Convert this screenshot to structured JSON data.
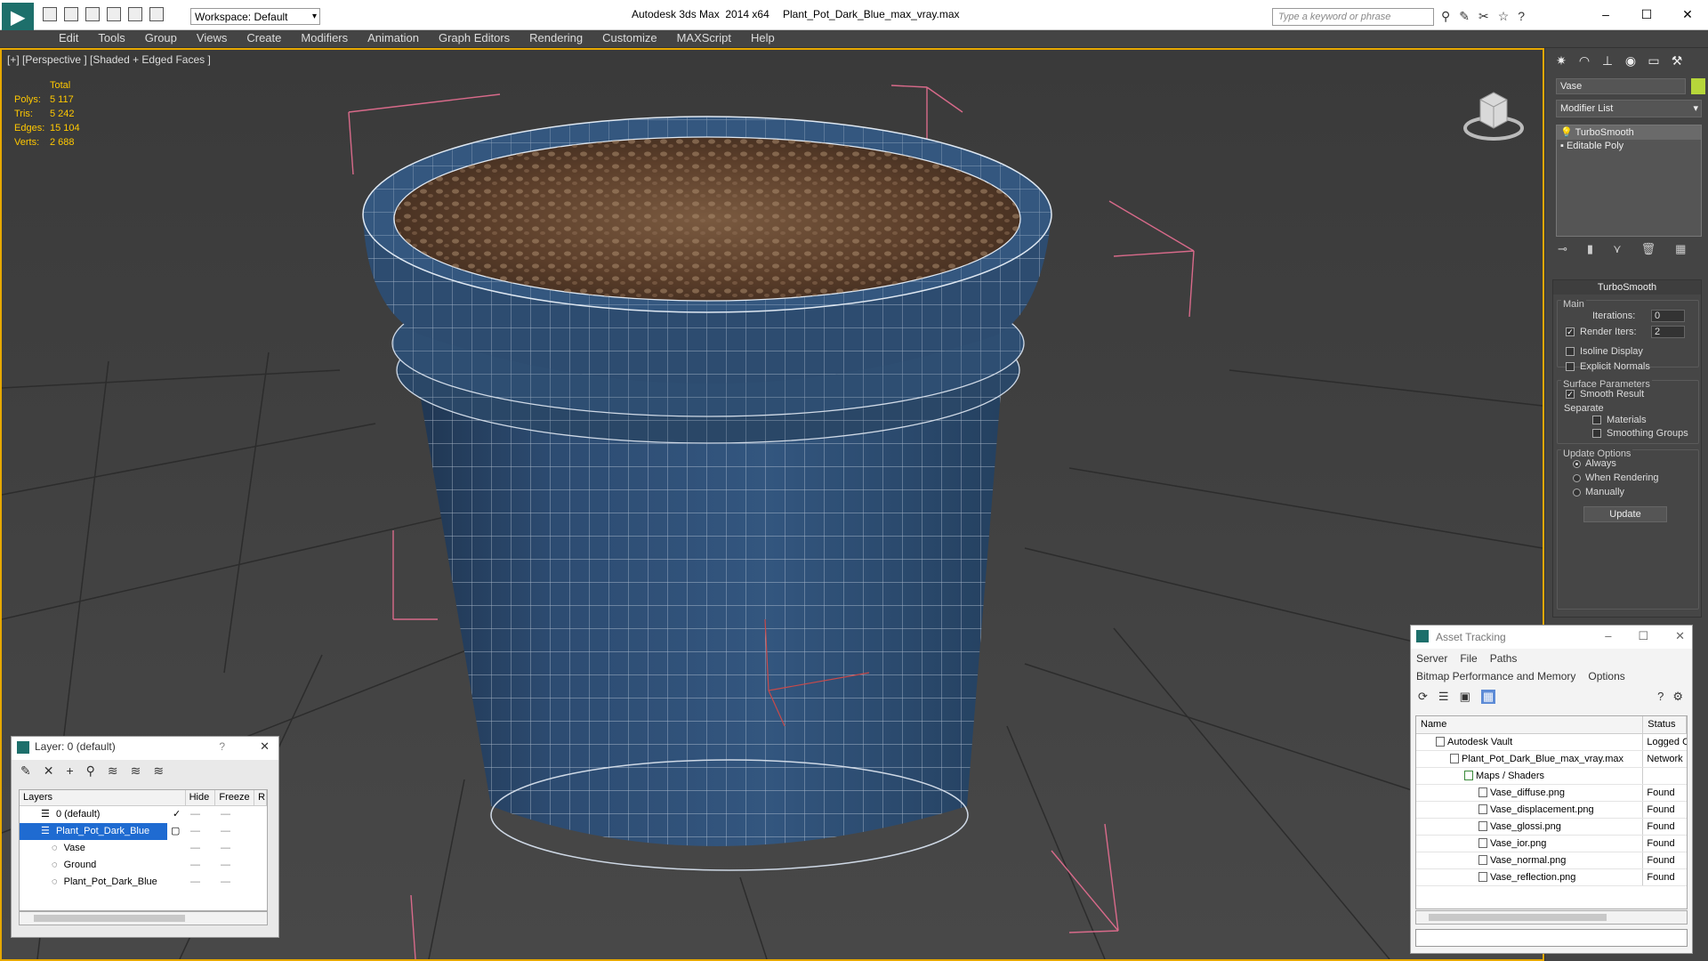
{
  "titlebar": {
    "workspace": "Workspace: Default",
    "app_title": "Autodesk 3ds Max  2014 x64",
    "file_title": "Plant_Pot_Dark_Blue_max_vray.max",
    "search_placeholder": "Type a keyword or phrase"
  },
  "menu": [
    "Edit",
    "Tools",
    "Group",
    "Views",
    "Create",
    "Modifiers",
    "Animation",
    "Graph Editors",
    "Rendering",
    "Customize",
    "MAXScript",
    "Help"
  ],
  "viewport": {
    "label": "[+] [Perspective ] [Shaded + Edged Faces ]",
    "stats": {
      "header": "Total",
      "rows": [
        {
          "k": "Polys:",
          "v": "5 117"
        },
        {
          "k": "Tris:",
          "v": "5 242"
        },
        {
          "k": "Edges:",
          "v": "15 104"
        },
        {
          "k": "Verts:",
          "v": "2 688"
        }
      ]
    }
  },
  "command_panel": {
    "object_name": "Vase",
    "object_color": "#b6d63a",
    "modifier_list": "Modifier List",
    "stack": [
      "TurboSmooth",
      "Editable Poly"
    ],
    "rollout_title": "TurboSmooth",
    "main_group": "Main",
    "iterations_label": "Iterations:",
    "iterations_value": "0",
    "render_iters_label": "Render Iters:",
    "render_iters_value": "2",
    "isoline_label": "Isoline Display",
    "explicit_normals_label": "Explicit Normals",
    "surface_group": "Surface Parameters",
    "smooth_result_label": "Smooth Result",
    "separate_label": "Separate",
    "materials_label": "Materials",
    "smoothing_groups_label": "Smoothing Groups",
    "update_group": "Update Options",
    "always_label": "Always",
    "when_rendering_label": "When Rendering",
    "manually_label": "Manually",
    "update_button": "Update"
  },
  "layer_window": {
    "title": "Layer: 0 (default)",
    "help": "?",
    "columns": [
      "Layers",
      "Hide",
      "Freeze",
      "R"
    ],
    "rows": [
      {
        "name": "0 (default)",
        "indent": 0
      },
      {
        "name": "Plant_Pot_Dark_Blue",
        "indent": 0
      },
      {
        "name": "Vase",
        "indent": 1
      },
      {
        "name": "Ground",
        "indent": 1
      },
      {
        "name": "Plant_Pot_Dark_Blue",
        "indent": 1
      }
    ]
  },
  "asset_window": {
    "title": "Asset Tracking",
    "menu1": [
      "Server",
      "File",
      "Paths"
    ],
    "menu2": [
      "Bitmap Performance and Memory",
      "Options"
    ],
    "columns": [
      "Name",
      "Status"
    ],
    "rows": [
      {
        "name": "Autodesk Vault",
        "status": "Logged O",
        "indent": 1
      },
      {
        "name": "Plant_Pot_Dark_Blue_max_vray.max",
        "status": "Network",
        "indent": 2
      },
      {
        "name": "Maps / Shaders",
        "status": "",
        "indent": 3
      },
      {
        "name": "Vase_diffuse.png",
        "status": "Found",
        "indent": 4
      },
      {
        "name": "Vase_displacement.png",
        "status": "Found",
        "indent": 4
      },
      {
        "name": "Vase_glossi.png",
        "status": "Found",
        "indent": 4
      },
      {
        "name": "Vase_ior.png",
        "status": "Found",
        "indent": 4
      },
      {
        "name": "Vase_normal.png",
        "status": "Found",
        "indent": 4
      },
      {
        "name": "Vase_reflection.png",
        "status": "Found",
        "indent": 4
      }
    ]
  }
}
